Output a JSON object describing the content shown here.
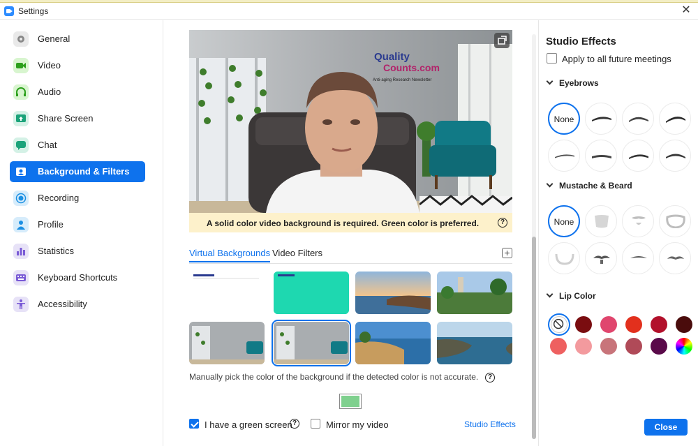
{
  "window": {
    "title": "Settings",
    "close_glyph": "✕"
  },
  "sidebar": {
    "items": [
      {
        "label": "General",
        "icon": "gear-icon",
        "color": "#e9e9e9"
      },
      {
        "label": "Video",
        "icon": "video-camera-icon",
        "color": "#d8f5cf"
      },
      {
        "label": "Audio",
        "icon": "headphones-icon",
        "color": "#d8f5cf"
      },
      {
        "label": "Share Screen",
        "icon": "share-screen-icon",
        "color": "#d4f1e6"
      },
      {
        "label": "Chat",
        "icon": "chat-bubble-icon",
        "color": "#d4f1e6"
      },
      {
        "label": "Background & Filters",
        "icon": "portrait-icon",
        "color": "#0e72ed"
      },
      {
        "label": "Recording",
        "icon": "record-icon",
        "color": "#d6ecfb"
      },
      {
        "label": "Profile",
        "icon": "person-icon",
        "color": "#d6ecfb"
      },
      {
        "label": "Statistics",
        "icon": "bar-chart-icon",
        "color": "#e7e2f7"
      },
      {
        "label": "Keyboard Shortcuts",
        "icon": "keyboard-icon",
        "color": "#e7e2f7"
      },
      {
        "label": "Accessibility",
        "icon": "accessibility-icon",
        "color": "#e7e2f7"
      }
    ],
    "active_index": 5
  },
  "preview": {
    "logo_line1": "Quality",
    "logo_line2": "Counts.com",
    "logo_tagline": "Anti-aging Research Newsletter",
    "warning": "A solid color video background is required. Green color is preferred."
  },
  "tabs": [
    {
      "label": "Virtual Backgrounds",
      "active": true
    },
    {
      "label": "Video Filters",
      "active": false
    }
  ],
  "add_button_glyph": "+",
  "backgrounds": [
    {
      "name": "qualitycounts-page",
      "selected": false
    },
    {
      "name": "solid-teal",
      "selected": false
    },
    {
      "name": "sunset-coast",
      "selected": false
    },
    {
      "name": "palm-hillside",
      "selected": false
    },
    {
      "name": "office-room",
      "selected": false
    },
    {
      "name": "office-room-green",
      "selected": true
    },
    {
      "name": "desert-beach",
      "selected": false
    },
    {
      "name": "ocean-cliffs",
      "selected": false
    }
  ],
  "manual_pick_text": "Manually pick the color of the background if the detected color is not accurate.",
  "picked_color": "#7fd08e",
  "green_screen": {
    "label": "I have a green screen",
    "checked": true
  },
  "mirror": {
    "label": "Mirror my video",
    "checked": false
  },
  "studio_effects_link": "Studio Effects",
  "studio": {
    "title": "Studio Effects",
    "apply_future": {
      "label": "Apply to all future meetings",
      "checked": false
    },
    "eyebrows": {
      "header": "Eyebrows",
      "none_label": "None"
    },
    "mustache": {
      "header": "Mustache & Beard",
      "none_label": "None"
    },
    "lip": {
      "header": "Lip Color",
      "colors": [
        "none",
        "#7a0d10",
        "#e0466e",
        "#e2301d",
        "#b2102b",
        "#4a0c0c",
        "#ee6060",
        "#f39a9e",
        "#c8747a",
        "#b04a58",
        "#5a0a4a",
        "rainbow"
      ]
    },
    "close_label": "Close"
  }
}
